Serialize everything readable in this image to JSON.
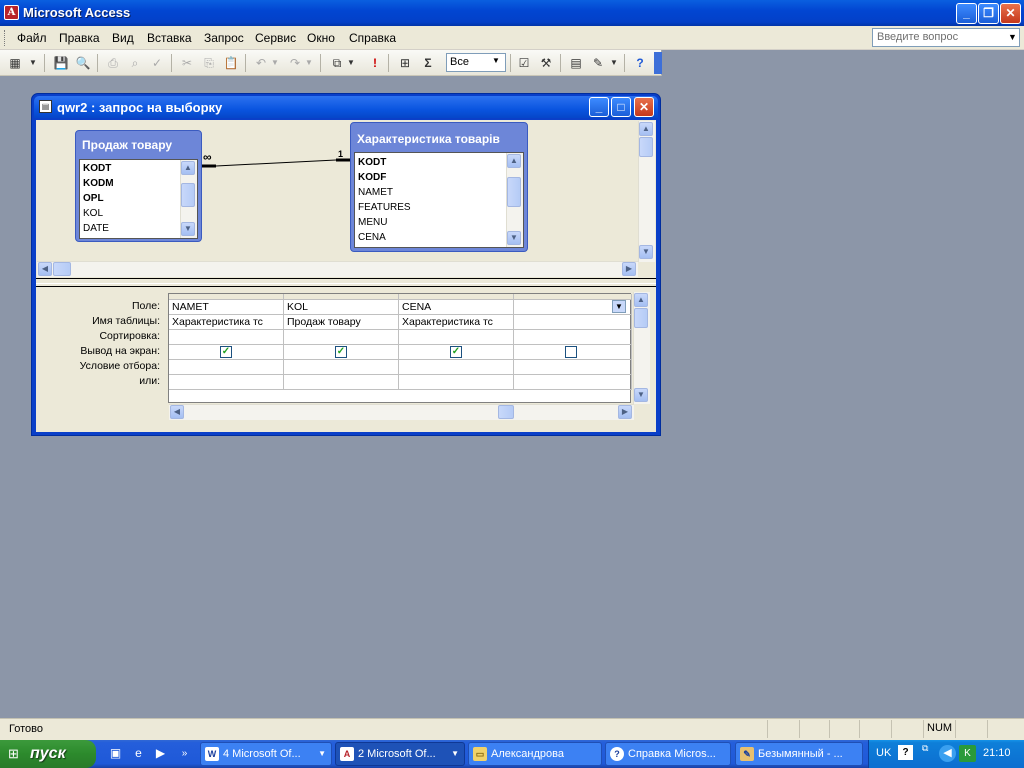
{
  "app": {
    "title": "Microsoft Access"
  },
  "menu": {
    "items": [
      "Файл",
      "Правка",
      "Вид",
      "Вставка",
      "Запрос",
      "Сервис",
      "Окно",
      "Справка"
    ],
    "help_placeholder": "Введите вопрос"
  },
  "toolbar": {
    "top_values": "Все"
  },
  "query_window": {
    "title": "qwr2 : запрос на выборку",
    "table1": {
      "name": "Продаж товару",
      "fields": [
        "KODT",
        "KODM",
        "OPL",
        "KOL",
        "DATE"
      ]
    },
    "table2": {
      "name": "Характеристика товарів",
      "fields": [
        "KODT",
        "KODF",
        "NAMET",
        "FEATURES",
        "MENU",
        "CENA"
      ]
    },
    "join": {
      "many": "∞",
      "one": "1"
    },
    "grid": {
      "row_labels": [
        "Поле:",
        "Имя таблицы:",
        "Сортировка:",
        "Вывод на экран:",
        "Условие отбора:",
        "или:"
      ],
      "columns": [
        {
          "field": "NAMET",
          "table": "Характеристика тс",
          "show": true
        },
        {
          "field": "KOL",
          "table": "Продаж товару",
          "show": true
        },
        {
          "field": "CENA",
          "table": "Характеристика тс",
          "show": true
        },
        {
          "field": "",
          "table": "",
          "show": false
        }
      ]
    }
  },
  "status": {
    "text": "Готово",
    "num": "NUM"
  },
  "taskbar": {
    "start": "пуск",
    "tasks": [
      "4 Microsoft Of...",
      "2 Microsoft Of...",
      "Александрова",
      "Справка Micros...",
      "Безымянный - ..."
    ],
    "lang": "UK",
    "time": "21:10"
  }
}
